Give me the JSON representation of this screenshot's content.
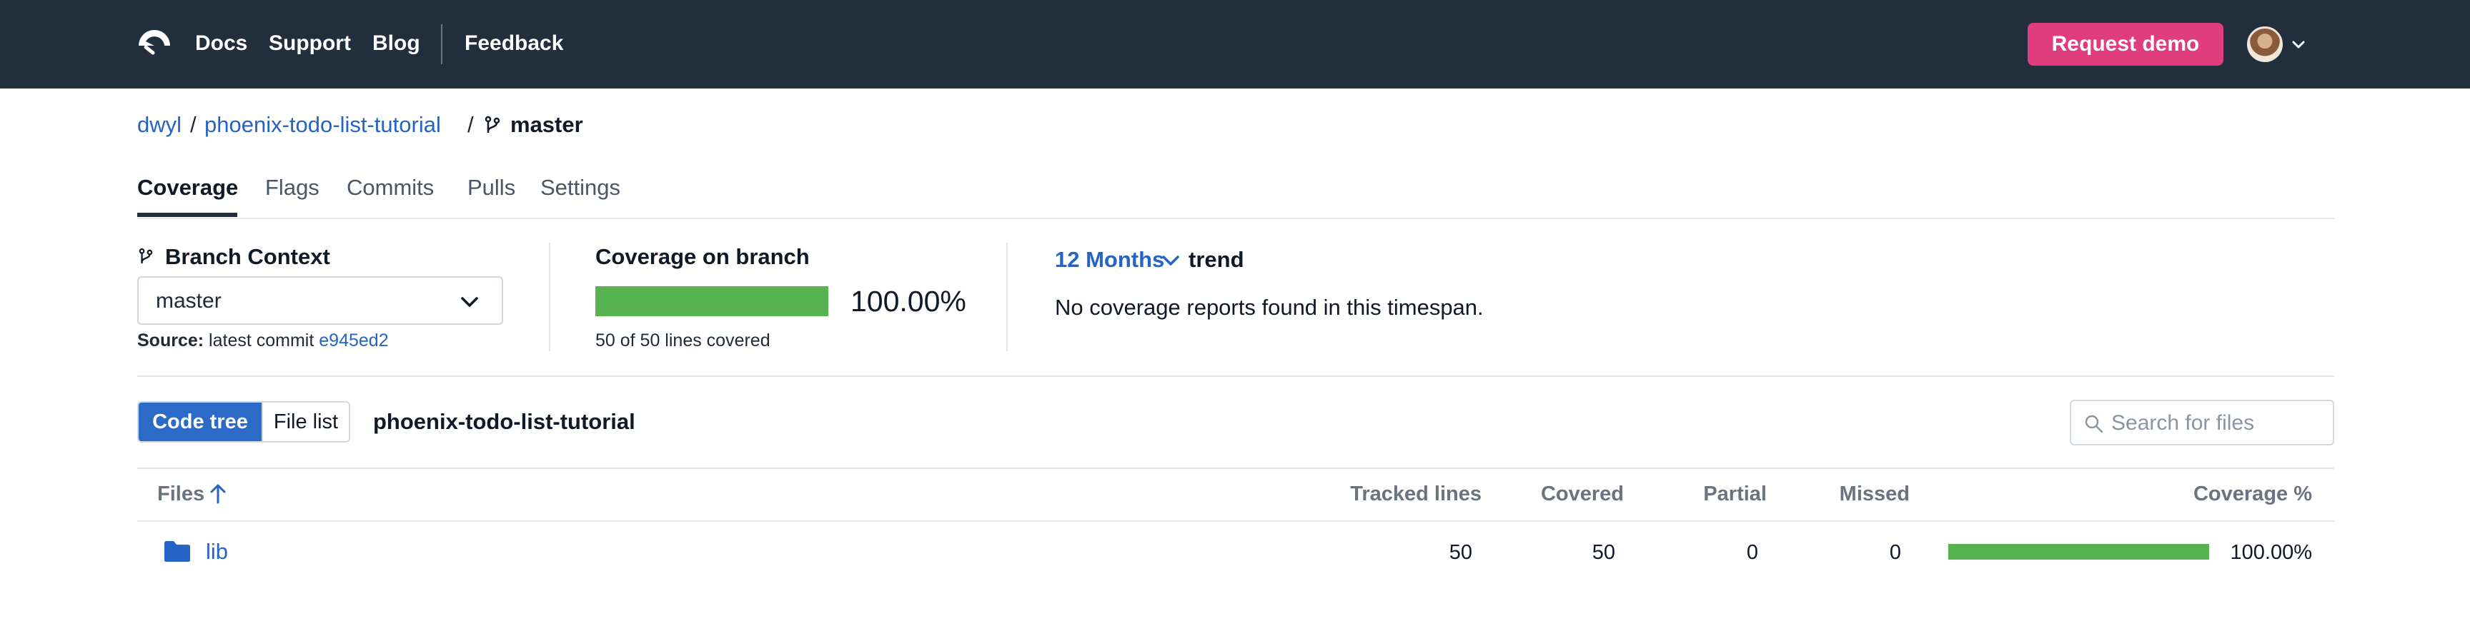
{
  "nav": {
    "links": [
      "Docs",
      "Support",
      "Blog"
    ],
    "feedback": "Feedback",
    "request_demo": "Request demo",
    "colors": {
      "bar": "#222e3b",
      "demo": "#e03d7f"
    }
  },
  "breadcrumb": {
    "owner": "dwyl",
    "repo": "phoenix-todo-list-tutorial",
    "separator": "/",
    "branch": "master"
  },
  "tabs": [
    {
      "label": "Coverage",
      "active": true
    },
    {
      "label": "Flags",
      "active": false
    },
    {
      "label": "Commits",
      "active": false
    },
    {
      "label": "Pulls",
      "active": false
    },
    {
      "label": "Settings",
      "active": false
    }
  ],
  "summary": {
    "branch_context": {
      "title": "Branch Context",
      "selected": "master",
      "source_label": "Source:",
      "source_text": "latest commit",
      "commit": "e945ed2"
    },
    "coverage": {
      "title": "Coverage on branch",
      "percent_value": 100,
      "percent_text": "100.00%",
      "lines_text": "50 of 50 lines covered"
    },
    "trend": {
      "period": "12 Months",
      "label": "trend",
      "empty_message": "No coverage reports found in this timespan."
    }
  },
  "toolbar": {
    "code_tree": "Code tree",
    "file_list": "File list",
    "repo_name": "phoenix-todo-list-tutorial",
    "search_placeholder": "Search for files"
  },
  "table": {
    "headers": {
      "files": "Files",
      "tracked": "Tracked lines",
      "covered": "Covered",
      "partial": "Partial",
      "missed": "Missed",
      "coverage": "Coverage %"
    },
    "rows": [
      {
        "name": "lib",
        "icon": "folder-icon",
        "tracked": "50",
        "covered": "50",
        "partial": "0",
        "missed": "0",
        "coverage_value": 100,
        "coverage_text": "100.00%"
      }
    ]
  }
}
